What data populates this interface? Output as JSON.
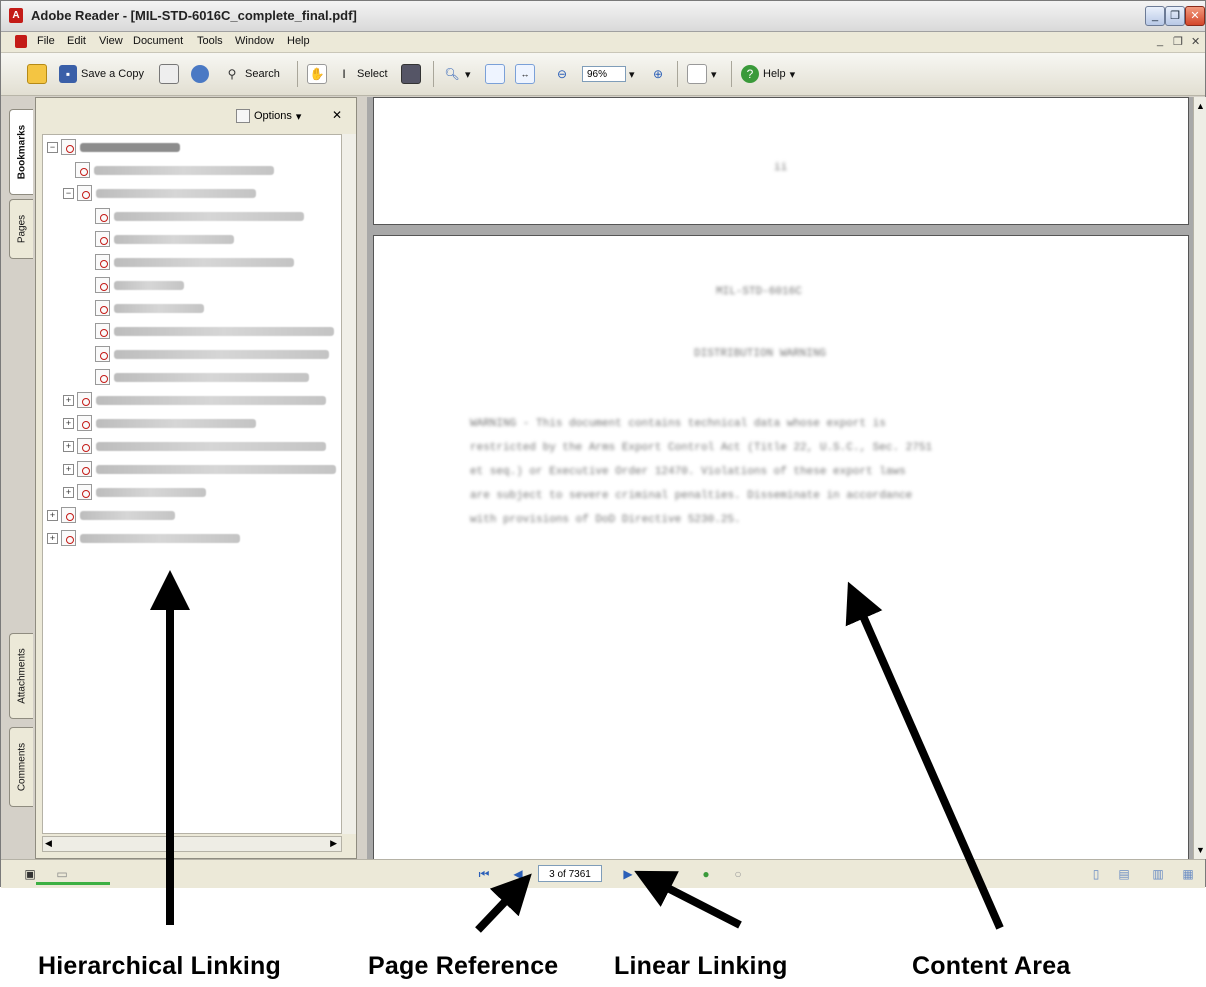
{
  "window": {
    "title": "Adobe Reader - [MIL-STD-6016C_complete_final.pdf]",
    "min_glyph": "_",
    "restore_glyph": "❐",
    "close_glyph": "✕",
    "doc_min_glyph": "_",
    "doc_restore_glyph": "❐",
    "doc_close_glyph": "✕"
  },
  "menu": {
    "items": [
      "File",
      "Edit",
      "View",
      "Document",
      "Tools",
      "Window",
      "Help"
    ]
  },
  "toolbar": {
    "save_copy_label": "Save a Copy",
    "search_label": "Search",
    "select_label": "Select",
    "zoom_value": "96%",
    "help_label": "Help"
  },
  "left_tabs": {
    "bookmarks": "Bookmarks",
    "pages": "Pages",
    "attachments": "Attachments",
    "comments": "Comments"
  },
  "bookmarks_panel": {
    "options_label": "Options",
    "close_glyph": "✕"
  },
  "document": {
    "page1_text": "ii",
    "page2_line1": "MIL-STD-6016C",
    "page2_line2": "DISTRIBUTION WARNING",
    "page2_para": [
      "WARNING - This document contains technical data whose export is",
      "restricted by the Arms Export Control Act (Title 22, U.S.C., Sec. 2751",
      "et seq.) or Executive Order 12470. Violations of these export laws",
      "are subject to severe criminal penalties. Disseminate in accordance",
      "with provisions of DoD Directive 5230.25."
    ]
  },
  "statusbar": {
    "page_reference": "3 of 7361"
  },
  "captions": {
    "hierarchical": "Hierarchical Linking",
    "page_reference": "Page Reference",
    "linear": "Linear Linking",
    "content_area": "Content Area"
  },
  "colors": {
    "adobe_red": "#c41b17",
    "panel_bg": "#ece9d8",
    "doc_bg": "#a8a8a8"
  }
}
